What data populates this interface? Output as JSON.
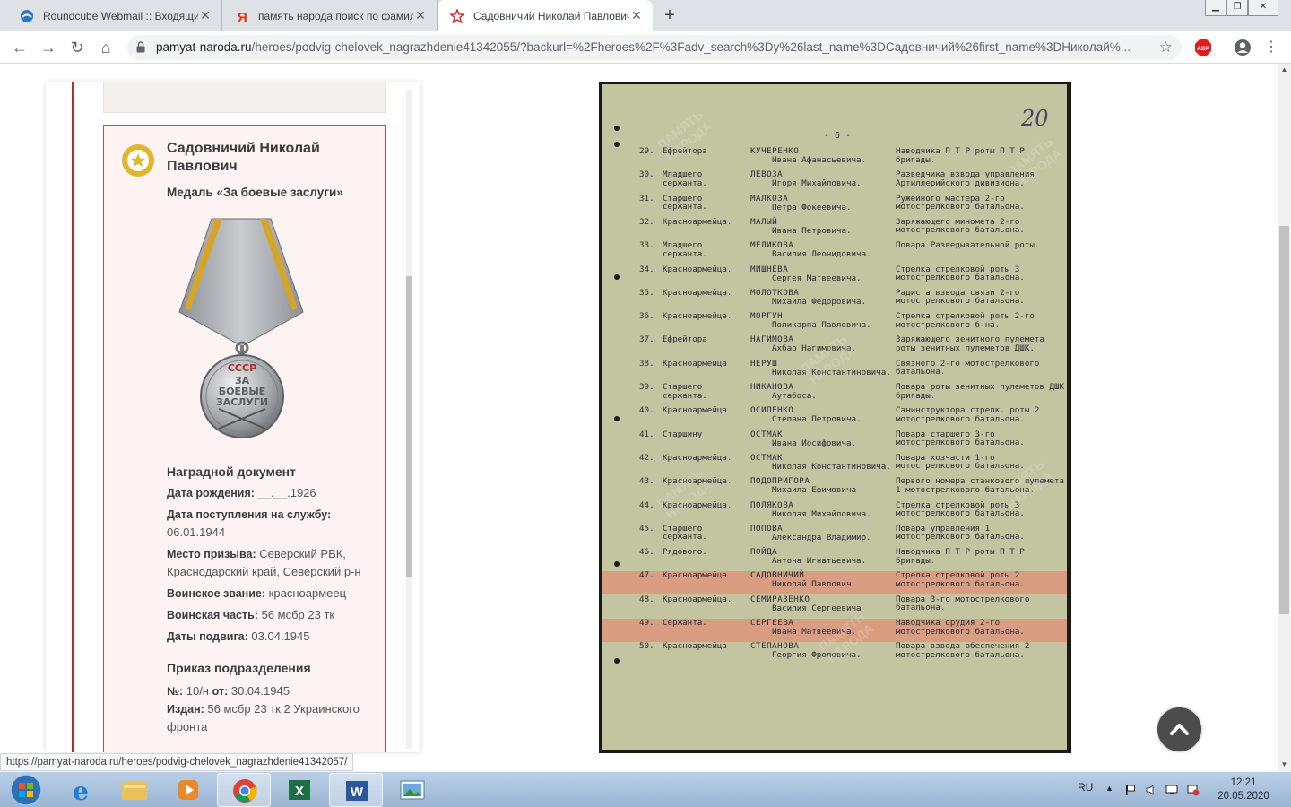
{
  "tabs": [
    {
      "title": "Roundcube Webmail :: Входящие",
      "favicon": "roundcube-icon",
      "active": false
    },
    {
      "title": "память народа поиск по фамил",
      "favicon": "yandex-icon",
      "active": false
    },
    {
      "title": "Садовничий Николай Павлович",
      "favicon": "star-icon",
      "active": true
    }
  ],
  "window_controls": [
    "minimize",
    "restore",
    "close"
  ],
  "omnibox": {
    "host": "pamyat-naroda.ru",
    "path": "/heroes/podvig-chelovek_nagrazhdenie41342055/?backurl=%2Fheroes%2F%3Fadv_search%3Dy%26last_name%3DСадовничий%26first_name%3DНиколай%..."
  },
  "extensions": {
    "abp_label": "ABP"
  },
  "card": {
    "name": "Садовничий Николай Павлович",
    "award": "Медаль «За боевые заслуги»",
    "medal_text": [
      "СССР",
      "ЗА",
      "БОЕВЫЕ",
      "ЗАСЛУГИ"
    ],
    "award_doc": {
      "title": "Наградной документ",
      "fields": [
        {
          "label": "Дата рождения:",
          "value": "__.__.1926"
        },
        {
          "label": "Дата поступления на службу:",
          "value": "06.01.1944"
        },
        {
          "label": "Место призыва:",
          "value": "Северский РВК, Краснодарский край, Северский р-н"
        },
        {
          "label": "Воинское звание:",
          "value": "красноармеец"
        },
        {
          "label": "Воинская часть:",
          "value": "56 мсбр 23 тк"
        },
        {
          "label": "Даты подвига:",
          "value": "03.04.1945"
        }
      ]
    },
    "order": {
      "title": "Приказ подразделения",
      "number_label": "№:",
      "number_value": "10/н",
      "date_label": "от:",
      "date_value": "30.04.1945",
      "issued_label": "Издан:",
      "issued_value": "56 мсбр 23 тк 2 Украинского фронта"
    }
  },
  "document": {
    "page_marker": "- 6 -",
    "page_number": "20",
    "watermark": "ПАМЯТЬ НАРОДА",
    "rows": [
      {
        "n": "29.",
        "rank": "Ефрейтора",
        "surname": "КУЧЕРЕНКО",
        "given": "Ивана Афанасьевича.",
        "duty": "Наводчика П Т Р роты П Т Р бригады.",
        "highlight": false
      },
      {
        "n": "30.",
        "rank": "Младшего сержанта.",
        "surname": "ЛЕВОЗА",
        "given": "Игоря Михайловича.",
        "duty": "Разведчика взвода управления Артиллерийского дивизиона.",
        "highlight": false
      },
      {
        "n": "31.",
        "rank": "Старшего сержанта.",
        "surname": "МАЛКОЗА",
        "given": "Петра Фокеевича.",
        "duty": "Ружейного мастера 2-го мотострелкового батальона.",
        "highlight": false
      },
      {
        "n": "32.",
        "rank": "Красноармейца.",
        "surname": "МАЛЫЙ",
        "given": "Ивана Петровича.",
        "duty": "Заряжающего миномета 2-го мотострелкового батальона.",
        "highlight": false
      },
      {
        "n": "33.",
        "rank": "Младшего сержанта.",
        "surname": "МЕЛИКОВА",
        "given": "Василия Леонидовича.",
        "duty": "Повара Разведывательной роты.",
        "highlight": false
      },
      {
        "n": "34.",
        "rank": "Красноармейца.",
        "surname": "МИШНЕВА",
        "given": "Сергея Матвеевича.",
        "duty": "Стрелка стрелковой роты 3 мотострелкового батальона.",
        "highlight": false
      },
      {
        "n": "35.",
        "rank": "Красноармейца.",
        "surname": "МОЛОТКОВА",
        "given": "Михаила Федоровича.",
        "duty": "Радиста взвода связи 2-го мотострелкового батальона.",
        "highlight": false
      },
      {
        "n": "36.",
        "rank": "Красноармейца.",
        "surname": "МОРГУН",
        "given": "Поликарпа Павловича.",
        "duty": "Стрелка стрелковой роты 2-го мотострелкового б-на.",
        "highlight": false
      },
      {
        "n": "37.",
        "rank": "Ефрейтора",
        "surname": "НАГИМОВА",
        "given": "Ахбар Нагимовича.",
        "duty": "Заряжающего зенитного пулемета роты зенитных пулеметов ДШК.",
        "highlight": false
      },
      {
        "n": "38.",
        "rank": "Красноармейца",
        "surname": "НЕРУШ",
        "given": "Николая Константиновича.",
        "duty": "Связного 2-го мотострелкового батальона.",
        "highlight": false
      },
      {
        "n": "39.",
        "rank": "Старшего сержанта.",
        "surname": "НИКАНОВА",
        "given": "Аутабоса.",
        "duty": "Повара роты зенитных пулеметов ДШК бригады.",
        "highlight": false
      },
      {
        "n": "40.",
        "rank": "Красноармейца",
        "surname": "ОСИПЕНКО",
        "given": "Степана Петровича.",
        "duty": "Санинструктора стрелк. роты 2 мотострелкового батальона.",
        "highlight": false
      },
      {
        "n": "41.",
        "rank": "Старшину",
        "surname": "ОСТМАК",
        "given": "Ивана Иосифовича.",
        "duty": "Повара старшего 3-го мотострелкового батальона.",
        "highlight": false
      },
      {
        "n": "42.",
        "rank": "Красноармейца.",
        "surname": "ОСТМАК",
        "given": "Николая Константиновича.",
        "duty": "Повара хозчасти 1-го мотострелкового батальона.",
        "highlight": false
      },
      {
        "n": "43.",
        "rank": "Красноармейца.",
        "surname": "ПОДОПРИГОРА",
        "given": "Михаила Ефимовича",
        "duty": "Первого номера станкового пулемета 1 мотострелкового батальона.",
        "highlight": false
      },
      {
        "n": "44.",
        "rank": "Красноармейца.",
        "surname": "ПОЛЯКОВА",
        "given": "Николая Михайловича.",
        "duty": "Стрелка стрелковой роты 3 мотострелкового батальона.",
        "highlight": false
      },
      {
        "n": "45.",
        "rank": "Старшего сержанта.",
        "surname": "ПОПОВА",
        "given": "Александра Владимир.",
        "duty": "Повара управления 1 мотострелкового батальона.",
        "highlight": false
      },
      {
        "n": "46.",
        "rank": "Рядового.",
        "surname": "ПОЙДА",
        "given": "Антона Игнатьевича.",
        "duty": "Наводчика П Т Р роты П Т Р бригады.",
        "highlight": false
      },
      {
        "n": "47.",
        "rank": "Красноармейца",
        "surname": "САДОВНИЧИЙ",
        "given": "Николай Павлович",
        "duty": "Стрелка стрелковой роты 2 мотострелкового батальона.",
        "highlight": true
      },
      {
        "n": "48.",
        "rank": "Красноармейца.",
        "surname": "СЕМИРАЗЕНКО",
        "given": "Василия Сергеевича",
        "duty": "Повара 3-го мотострелкового батальона.",
        "highlight": false
      },
      {
        "n": "49.",
        "rank": "Сержанта.",
        "surname": "СЕРГЕЕВА",
        "given": "Ивана Матвеевича.",
        "duty": "Наводчика орудия 2-го мотострелкового батальона.",
        "highlight": true
      },
      {
        "n": "50.",
        "rank": "Красноармейца",
        "surname": "СТЕПАНОВА",
        "given": "Георгия Фроловича.",
        "duty": "Повара взвода обеспечения 2 мотострелкового батальона.",
        "highlight": false
      }
    ]
  },
  "status_url": "https://pamyat-naroda.ru/heroes/podvig-chelovek_nagrazhdenie41342057/",
  "taskbar": {
    "apps": [
      "windows-explorer",
      "internet-explorer",
      "media-player",
      "chrome",
      "excel",
      "word",
      "picture-viewer"
    ],
    "language": "RU",
    "time": "12:21",
    "date": "20.05.2020"
  },
  "colors": {
    "accent_red": "#b72b2b",
    "card_bg": "#fdf3f3",
    "medal_gold": "#e2b62c",
    "highlight": "#ec7e6a",
    "paper": "#c3c4a0"
  }
}
